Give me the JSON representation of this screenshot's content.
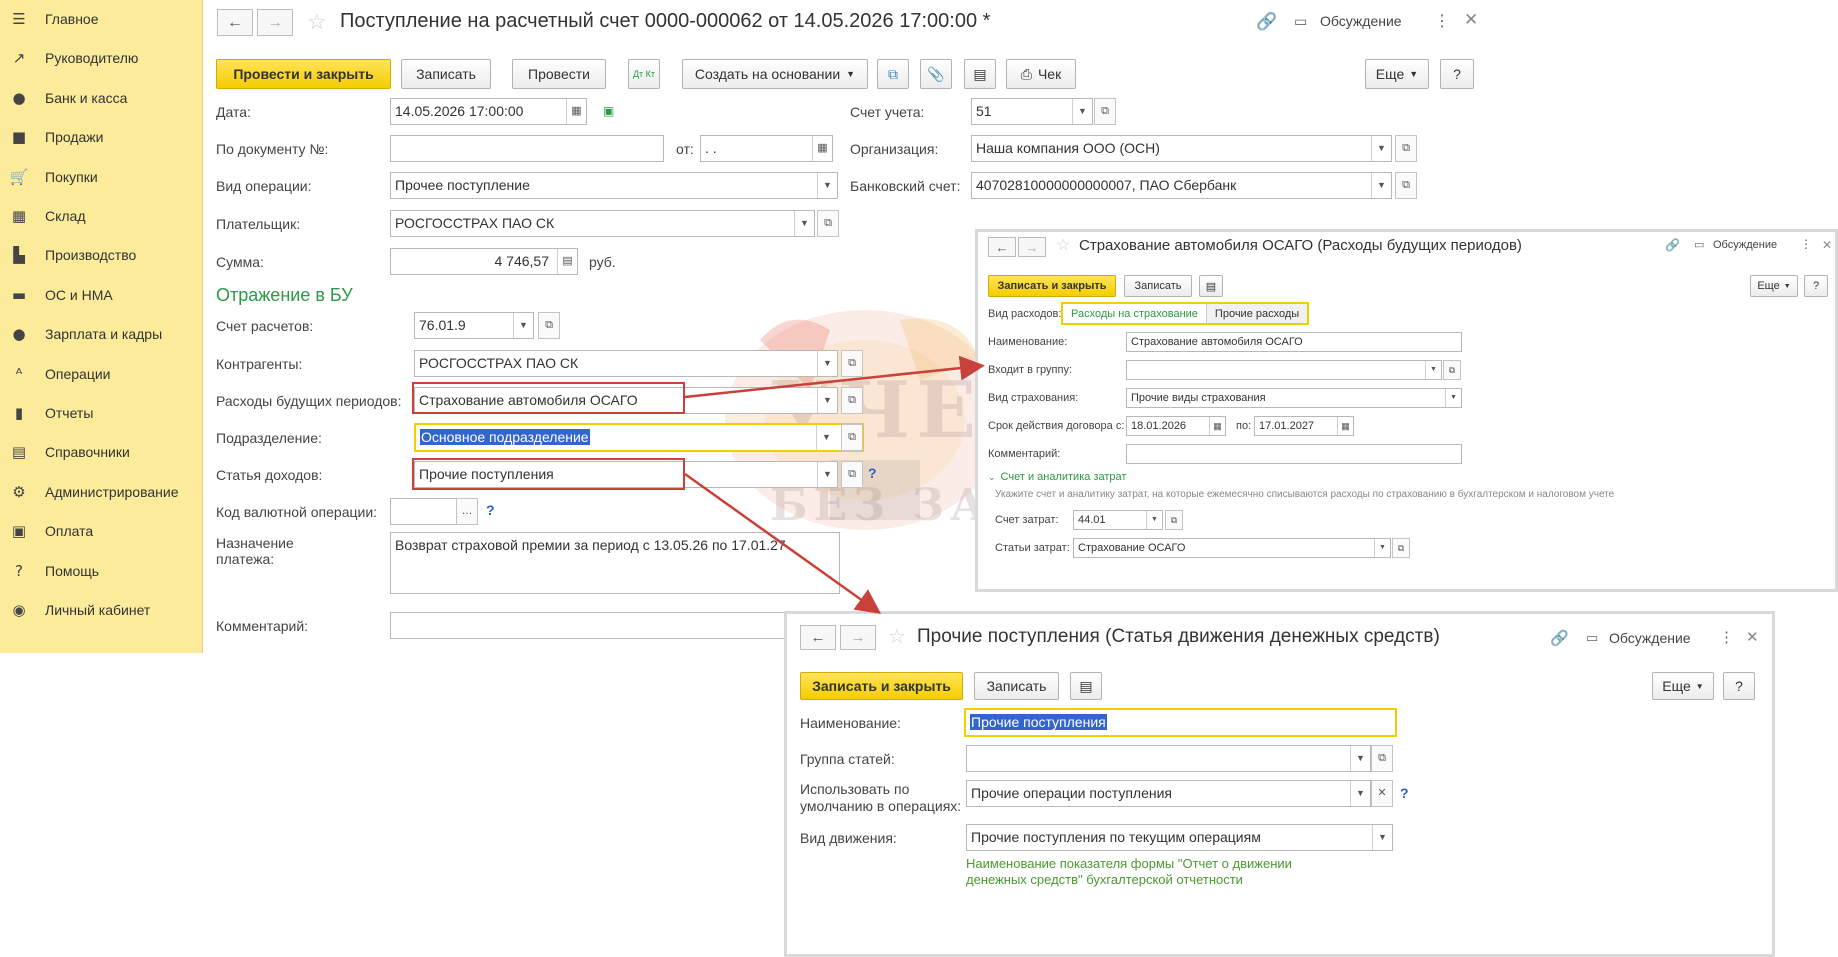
{
  "sidebar": {
    "items": [
      {
        "label": "Главное",
        "icon": "menu-icon",
        "glyph": "☰"
      },
      {
        "label": "Руководителю",
        "icon": "trend-icon",
        "glyph": "↗"
      },
      {
        "label": "Банк и касса",
        "icon": "coin-icon",
        "glyph": "●"
      },
      {
        "label": "Продажи",
        "icon": "bag-icon",
        "glyph": "■"
      },
      {
        "label": "Покупки",
        "icon": "cart-icon",
        "glyph": "🛒"
      },
      {
        "label": "Склад",
        "icon": "warehouse-icon",
        "glyph": "▦"
      },
      {
        "label": "Производство",
        "icon": "factory-icon",
        "glyph": "▙"
      },
      {
        "label": "ОС и НМА",
        "icon": "truck-icon",
        "glyph": "▬"
      },
      {
        "label": "Зарплата и кадры",
        "icon": "person-icon",
        "glyph": "●"
      },
      {
        "label": "Операции",
        "icon": "operations-icon",
        "glyph": "ᴬ"
      },
      {
        "label": "Отчеты",
        "icon": "bar-chart-icon",
        "glyph": "▮"
      },
      {
        "label": "Справочники",
        "icon": "book-icon",
        "glyph": "▤"
      },
      {
        "label": "Администрирование",
        "icon": "gear-icon",
        "glyph": "⚙"
      },
      {
        "label": "Оплата",
        "icon": "wallet-icon",
        "glyph": "▣"
      },
      {
        "label": "Помощь",
        "icon": "help-icon",
        "glyph": "?"
      },
      {
        "label": "Личный кабинет",
        "icon": "account-icon",
        "glyph": "◉"
      }
    ]
  },
  "main": {
    "title": "Поступление на расчетный счет 0000-000062 от 14.05.2026 17:00:00 *",
    "discussion": "Обсуждение",
    "toolbar": {
      "post_close": "Провести и закрыть",
      "save": "Записать",
      "post": "Провести",
      "dtkt": "Дт Кт",
      "create_based": "Создать на основании",
      "receipt": "Чек",
      "more": "Еще",
      "help": "?"
    },
    "fields": {
      "date_label": "Дата:",
      "date_value": "14.05.2026 17:00:00",
      "doc_no_label": "По документу №:",
      "doc_no_value": "",
      "from_label": "от:",
      "from_value": " .  .",
      "op_type_label": "Вид операции:",
      "op_type_value": "Прочее поступление",
      "payer_label": "Плательщик:",
      "payer_value": "РОСГОССТРАХ ПАО СК",
      "sum_label": "Сумма:",
      "sum_value": "4 746,57",
      "currency": "руб.",
      "account_label": "Счет учета:",
      "account_value": "51",
      "org_label": "Организация:",
      "org_value": "Наша компания ООО (ОСН)",
      "bank_label": "Банковский счет:",
      "bank_value": "40702810000000000007, ПАО Сбербанк"
    },
    "section_title": "Отражение в БУ",
    "bu": {
      "settle_label": "Счет расчетов:",
      "settle_value": "76.01.9",
      "contr_label": "Контрагенты:",
      "contr_value": "РОСГОССТРАХ ПАО СК",
      "rbp_label": "Расходы будущих периодов:",
      "rbp_value": "Страхование автомобиля ОСАГО",
      "dept_label": "Подразделение:",
      "dept_value": "Основное подразделение",
      "income_label": "Статья доходов:",
      "income_value": "Прочие поступления",
      "currency_op_label": "Код валютной операции:",
      "currency_op_value": "",
      "purpose_label": "Назначение платежа:",
      "purpose_value": "Возврат страховой премии за период с 13.05.26 по 17.01.27",
      "comment_label": "Комментарий:",
      "comment_value": ""
    }
  },
  "dialog1": {
    "title": "Страхование автомобиля ОСАГО (Расходы будущих периодов)",
    "discussion": "Обсуждение",
    "save_close": "Записать и закрыть",
    "save": "Записать",
    "more": "Еще",
    "help": "?",
    "kind_label": "Вид расходов:",
    "tab_active": "Расходы на страхование",
    "tab_other": "Прочие расходы",
    "name_label": "Наименование:",
    "name_value": "Страхование автомобиля ОСАГО",
    "group_label": "Входит в группу:",
    "group_value": "",
    "ins_kind_label": "Вид страхования:",
    "ins_kind_value": "Прочие виды страхования",
    "period_label": "Срок действия договора с:",
    "period_from": "18.01.2026",
    "period_to_label": "по:",
    "period_to": "17.01.2027",
    "comment_label": "Комментарий:",
    "comment_value": "",
    "section": "Счет и аналитика затрат",
    "hint": "Укажите счет и аналитику затрат, на которые ежемесячно списываются расходы по страхованию в бухгалтерском и налоговом учете",
    "cost_acc_label": "Счет затрат:",
    "cost_acc_value": "44.01",
    "cost_items_label": "Статьи затрат:",
    "cost_items_value": "Страхование ОСАГО"
  },
  "dialog2": {
    "title": "Прочие поступления (Статья движения денежных средств)",
    "discussion": "Обсуждение",
    "save_close": "Записать и закрыть",
    "save": "Записать",
    "more": "Еще",
    "help": "?",
    "name_label": "Наименование:",
    "name_value": "Прочие поступления",
    "group_label": "Группа статей:",
    "group_value": "",
    "default_label_1": "Использовать по",
    "default_label_2": "умолчанию в операциях:",
    "default_value": "Прочие операции поступления",
    "movement_label": "Вид движения:",
    "movement_value": "Прочие поступления по текущим операциям",
    "note_1": "Наименование показателя формы \"Отчет о движении",
    "note_2": "денежных средств\" бухгалтерской отчетности"
  },
  "colors": {
    "sidebar_bg": "#fbeb9a",
    "primary_button": "#f5cd00",
    "section_green": "#2b9a46",
    "annotation_red": "#c8413a",
    "selection_blue": "#3366cc"
  }
}
